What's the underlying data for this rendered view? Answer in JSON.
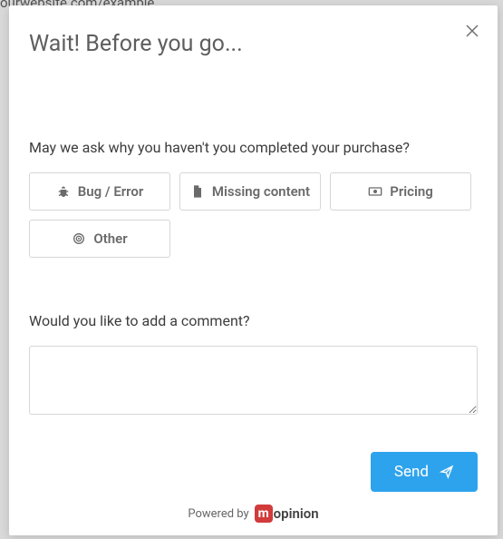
{
  "backdrop_url": "ourwebsite.com/example",
  "modal": {
    "title": "Wait! Before you go...",
    "question1": "May we ask why you haven't you completed your purchase?",
    "options": {
      "bug": "Bug / Error",
      "missing": "Missing content",
      "pricing": "Pricing",
      "other": "Other"
    },
    "question2": "Would you like to add a comment?",
    "comment_value": "",
    "send_label": "Send",
    "powered_by": "Powered by",
    "brand_m": "m",
    "brand_rest": "opinion"
  }
}
